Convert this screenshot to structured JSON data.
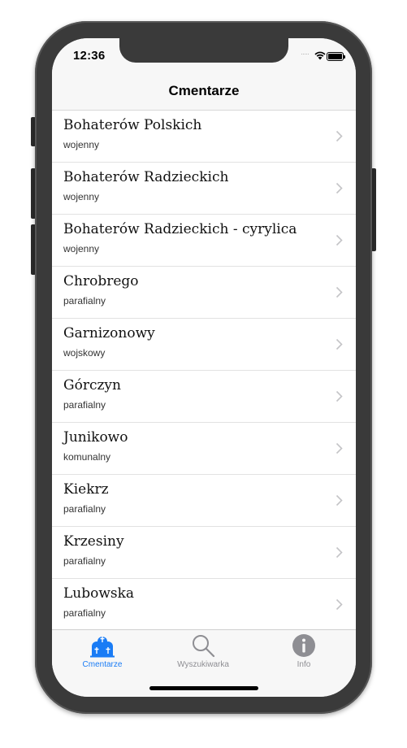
{
  "status": {
    "time": "12:36"
  },
  "nav": {
    "title": "Cmentarze"
  },
  "items": [
    {
      "title": "Bohaterów Polskich",
      "subtitle": "wojenny"
    },
    {
      "title": "Bohaterów Radzieckich",
      "subtitle": "wojenny"
    },
    {
      "title": "Bohaterów Radzieckich - cyrylica",
      "subtitle": "wojenny"
    },
    {
      "title": "Chrobrego",
      "subtitle": "parafialny"
    },
    {
      "title": "Garnizonowy",
      "subtitle": "wojskowy"
    },
    {
      "title": "Górczyn",
      "subtitle": "parafialny"
    },
    {
      "title": "Junikowo",
      "subtitle": "komunalny"
    },
    {
      "title": "Kiekrz",
      "subtitle": "parafialny"
    },
    {
      "title": "Krzesiny",
      "subtitle": "parafialny"
    },
    {
      "title": "Lubowska",
      "subtitle": "parafialny"
    }
  ],
  "tabs": [
    {
      "label": "Cmentarze",
      "icon": "cemetery-icon",
      "active": true
    },
    {
      "label": "Wyszukiwarka",
      "icon": "search-icon",
      "active": false
    },
    {
      "label": "Info",
      "icon": "info-icon",
      "active": false
    }
  ],
  "colors": {
    "accent": "#1a7cf5",
    "inactive": "#8e8e93"
  }
}
